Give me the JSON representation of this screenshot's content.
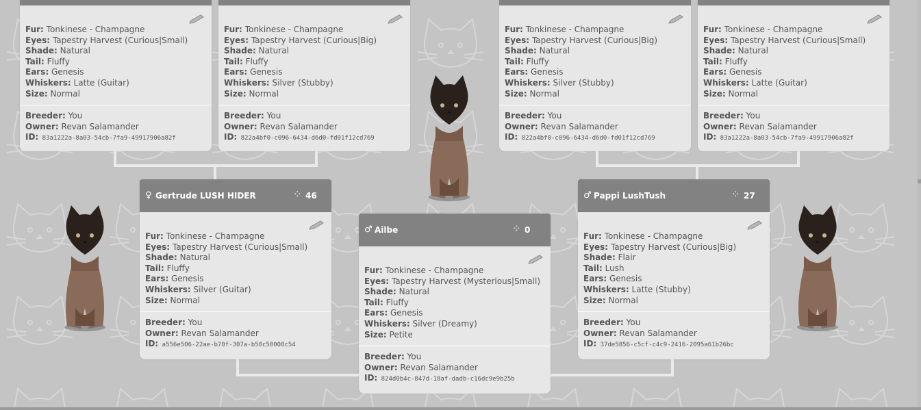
{
  "labels": {
    "fur": "Fur:",
    "eyes": "Eyes:",
    "shade": "Shade:",
    "tail": "Tail:",
    "ears": "Ears:",
    "whiskers": "Whiskers:",
    "size": "Size:",
    "breeder": "Breeder:",
    "owner": "Owner:",
    "id": "ID:"
  },
  "grandparents": [
    {
      "fur": "Tonkinese - Champagne",
      "eyes": "Tapestry Harvest (Curious|Small)",
      "shade": "Natural",
      "tail": "Fluffy",
      "ears": "Genesis",
      "whiskers": "Latte (Guitar)",
      "size": "Normal",
      "breeder": "You",
      "owner": "Revan Salamander",
      "id": "83a1222a-8a03-54cb-7fa9-49917906a82f"
    },
    {
      "fur": "Tonkinese - Champagne",
      "eyes": "Tapestry Harvest (Curious|Big)",
      "shade": "Natural",
      "tail": "Fluffy",
      "ears": "Genesis",
      "whiskers": "Silver (Stubby)",
      "size": "Normal",
      "breeder": "You",
      "owner": "Revan Salamander",
      "id": "822a4bf0-c096-6434-d6d0-fd01f12cd769"
    },
    {
      "fur": "Tonkinese - Champagne",
      "eyes": "Tapestry Harvest (Curious|Big)",
      "shade": "Natural",
      "tail": "Fluffy",
      "ears": "Genesis",
      "whiskers": "Silver (Stubby)",
      "size": "Normal",
      "breeder": "You",
      "owner": "Revan Salamander",
      "id": "822a4bf0-c096-6434-d6d0-fd01f12cd769"
    },
    {
      "fur": "Tonkinese - Champagne",
      "eyes": "Tapestry Harvest (Curious|Small)",
      "shade": "Natural",
      "tail": "Fluffy",
      "ears": "Genesis",
      "whiskers": "Latte (Guitar)",
      "size": "Normal",
      "breeder": "You",
      "owner": "Revan Salamander",
      "id": "83a1222a-8a03-54cb-7fa9-49917906a82f"
    }
  ],
  "mother": {
    "gender_symbol": "♀",
    "name": "Gertrude LUSH HIDER",
    "count": "46",
    "fur": "Tonkinese - Champagne",
    "eyes": "Tapestry Harvest (Curious|Small)",
    "shade": "Natural",
    "tail": "Fluffy",
    "ears": "Genesis",
    "whiskers": "Silver (Guitar)",
    "size": "Normal",
    "breeder": "You",
    "owner": "Revan Salamander",
    "id": "a556e506-22ae-b70f-307a-b58c50008c54"
  },
  "father": {
    "gender_symbol": "♂",
    "name": "Pappi LushTush",
    "count": "27",
    "fur": "Tonkinese - Champagne",
    "eyes": "Tapestry Harvest (Curious|Big)",
    "shade": "Flair",
    "tail": "Lush",
    "ears": "Genesis",
    "whiskers": "Latte (Stubby)",
    "size": "Normal",
    "breeder": "You",
    "owner": "Revan Salamander",
    "id": "37de5856-c5cf-c4c9-2416-2095a61b26bc"
  },
  "child": {
    "gender_symbol": "♂",
    "name": "Ailbe",
    "count": "0",
    "fur": "Tonkinese - Champagne",
    "eyes": "Tapestry Harvest (Mysterious|Small)",
    "shade": "Natural",
    "tail": "Fluffy",
    "ears": "Genesis",
    "whiskers": "Silver (Dreamy)",
    "size": "Petite",
    "breeder": "You",
    "owner": "Revan Salamander",
    "id": "824d0b4c-847d-18af-dadb-c16dc9e9b25b"
  },
  "icons": {
    "edit": "pencil-edit-icon",
    "age": "spinner-age-icon",
    "female": "female-symbol-icon",
    "male": "male-symbol-icon"
  },
  "colors": {
    "header": "#828282",
    "card": "#e7e7e7",
    "background": "#c4c4c4",
    "connector": "#eaeaea"
  }
}
